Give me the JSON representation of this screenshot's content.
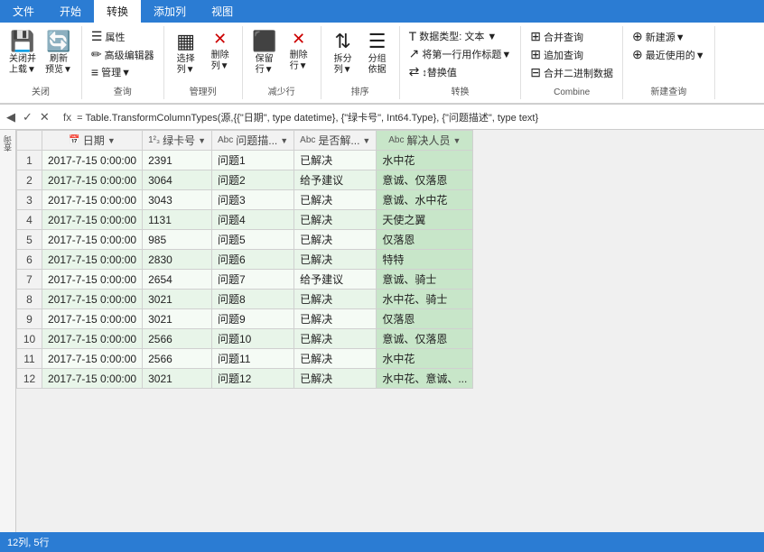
{
  "ribbon": {
    "tabs": [
      "文件",
      "开始",
      "转换",
      "添加列",
      "视图"
    ],
    "active_tab": "转换",
    "groups": [
      {
        "label": "关闭",
        "items": [
          {
            "type": "large",
            "icon": "💾",
            "label": "关闭并\n上载▼"
          },
          {
            "type": "large",
            "icon": "🔄",
            "label": "刷新\n预览▼"
          }
        ]
      },
      {
        "label": "查询",
        "items": [
          {
            "type": "small",
            "icon": "☰",
            "label": "属性"
          },
          {
            "type": "small",
            "icon": "✏",
            "label": "高级编辑器"
          },
          {
            "type": "small",
            "icon": "≡",
            "label": "管理▼"
          }
        ]
      },
      {
        "label": "管理列",
        "items": [
          {
            "type": "large",
            "icon": "▦",
            "label": "选择\n列▼"
          },
          {
            "type": "large",
            "icon": "✕",
            "label": "删除\n列▼"
          }
        ]
      },
      {
        "label": "减少行",
        "items": [
          {
            "type": "large",
            "icon": "⬛",
            "label": "保留\n行▼"
          },
          {
            "type": "large",
            "icon": "✕",
            "label": "删除\n行▼"
          }
        ]
      },
      {
        "label": "排序",
        "items": [
          {
            "type": "large",
            "icon": "⇅",
            "label": "拆分\n列▼"
          },
          {
            "type": "large",
            "icon": "☰",
            "label": "分组\n依据"
          }
        ]
      },
      {
        "label": "转换",
        "items": [
          {
            "type": "small",
            "icon": "T",
            "label": "数据类型: 文本"
          },
          {
            "type": "small",
            "icon": "↗",
            "label": "将第一行用作标题▼"
          },
          {
            "type": "small",
            "icon": "⇄",
            "label": "↕替换值"
          }
        ]
      },
      {
        "label": "Combine",
        "items": [
          {
            "type": "small",
            "icon": "⊞",
            "label": "合并查询"
          },
          {
            "type": "small",
            "icon": "⊞",
            "label": "追加查询"
          },
          {
            "type": "small",
            "icon": "⊟",
            "label": "合并二进制数据"
          }
        ]
      },
      {
        "label": "新建查询",
        "items": [
          {
            "type": "small",
            "icon": "⊕",
            "label": "新建源▼"
          },
          {
            "type": "small",
            "icon": "⊕",
            "label": "最近使用的▼"
          }
        ]
      }
    ],
    "formula": "= Table.TransformColumnTypes(源,{{\"日期\", type datetime}, {\"绿卡号\", Int64.Type}, {\"问题描述\", type text}",
    "formula_prefix": "fx"
  },
  "columns": [
    {
      "type_icon": "📅",
      "type_code": "1²₃",
      "name": "日期"
    },
    {
      "type_icon": "1²₃",
      "type_code": "1²₃",
      "name": "绿卡号"
    },
    {
      "type_icon": "Aᴮᶜ",
      "type_code": "Abc",
      "name": "问题描..."
    },
    {
      "type_icon": "Aᴮᶜ",
      "type_code": "Abc",
      "name": "是否解..."
    },
    {
      "type_icon": "Aᴮᶜ",
      "type_code": "Abc",
      "name": "解决人员"
    }
  ],
  "rows": [
    {
      "id": 1,
      "date": "2017-7-15 0:00:00",
      "card": 2391,
      "issue": "问题1",
      "resolved": "已解决",
      "person": "水中花"
    },
    {
      "id": 2,
      "date": "2017-7-15 0:00:00",
      "card": 3064,
      "issue": "问题2",
      "resolved": "给予建议",
      "person": "意诚、仅落恩"
    },
    {
      "id": 3,
      "date": "2017-7-15 0:00:00",
      "card": 3043,
      "issue": "问题3",
      "resolved": "已解决",
      "person": "意诚、水中花"
    },
    {
      "id": 4,
      "date": "2017-7-15 0:00:00",
      "card": 1131,
      "issue": "问题4",
      "resolved": "已解决",
      "person": "天使之翼"
    },
    {
      "id": 5,
      "date": "2017-7-15 0:00:00",
      "card": 985,
      "issue": "问题5",
      "resolved": "已解决",
      "person": "仅落恩"
    },
    {
      "id": 6,
      "date": "2017-7-15 0:00:00",
      "card": 2830,
      "issue": "问题6",
      "resolved": "已解决",
      "person": "特特"
    },
    {
      "id": 7,
      "date": "2017-7-15 0:00:00",
      "card": 2654,
      "issue": "问题7",
      "resolved": "给予建议",
      "person": "意诚、骑士"
    },
    {
      "id": 8,
      "date": "2017-7-15 0:00:00",
      "card": 3021,
      "issue": "问题8",
      "resolved": "已解决",
      "person": "水中花、骑士"
    },
    {
      "id": 9,
      "date": "2017-7-15 0:00:00",
      "card": 3021,
      "issue": "问题9",
      "resolved": "已解决",
      "person": "仅落恩"
    },
    {
      "id": 10,
      "date": "2017-7-15 0:00:00",
      "card": 2566,
      "issue": "问题10",
      "resolved": "已解决",
      "person": "意诚、仅落恩"
    },
    {
      "id": 11,
      "date": "2017-7-15 0:00:00",
      "card": 2566,
      "issue": "问题11",
      "resolved": "已解决",
      "person": "水中花"
    },
    {
      "id": 12,
      "date": "2017-7-15 0:00:00",
      "card": 3021,
      "issue": "问题12",
      "resolved": "已解决",
      "person": "水中花、意诚、..."
    }
  ]
}
